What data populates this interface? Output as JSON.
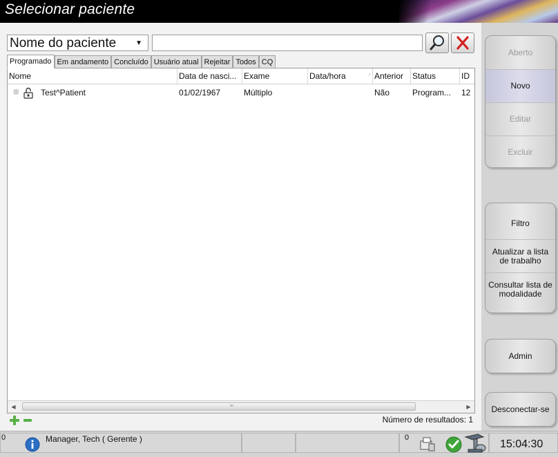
{
  "title": "Selecionar paciente",
  "search": {
    "type_label": "Nome do paciente",
    "query": "",
    "placeholder": ""
  },
  "tabs": [
    {
      "label": "Programado",
      "active": true
    },
    {
      "label": "Em andamento",
      "active": false
    },
    {
      "label": "Concluído",
      "active": false
    },
    {
      "label": "Usuário atual",
      "active": false
    },
    {
      "label": "Rejeitar",
      "active": false
    },
    {
      "label": "Todos",
      "active": false
    },
    {
      "label": "CQ",
      "active": false
    }
  ],
  "table": {
    "columns": [
      "Nome",
      "Data de nasci...",
      "Exame",
      "Data/hora",
      "Anterior",
      "Status",
      "ID"
    ],
    "rows": [
      {
        "name": "Test^Patient",
        "dob": "01/02/1967",
        "exam": "Múltiplo",
        "datetime": "",
        "anterior": "Não",
        "status": "Program...",
        "id": "12"
      }
    ],
    "scroll_grip": "'''"
  },
  "results_label": "Número de resultados: 1",
  "sidebar": {
    "aberto": "Aberto",
    "novo": "Novo",
    "editar": "Editar",
    "excluir": "Excluir",
    "filtro": "Filtro",
    "atualizar": "Atualizar a lista de trabalho",
    "consultar": "Consultar lista de modalidade",
    "admin": "Admin",
    "desconectar": "Desconectar-se"
  },
  "statusbar": {
    "count_left": "0",
    "user": "Manager, Tech ( Gerente )",
    "count_right": "0",
    "time": "15:04:30"
  },
  "colors": {
    "accent_highlight": "#d8d8ea",
    "add_green": "#58b048",
    "clear_red": "#d42020"
  }
}
